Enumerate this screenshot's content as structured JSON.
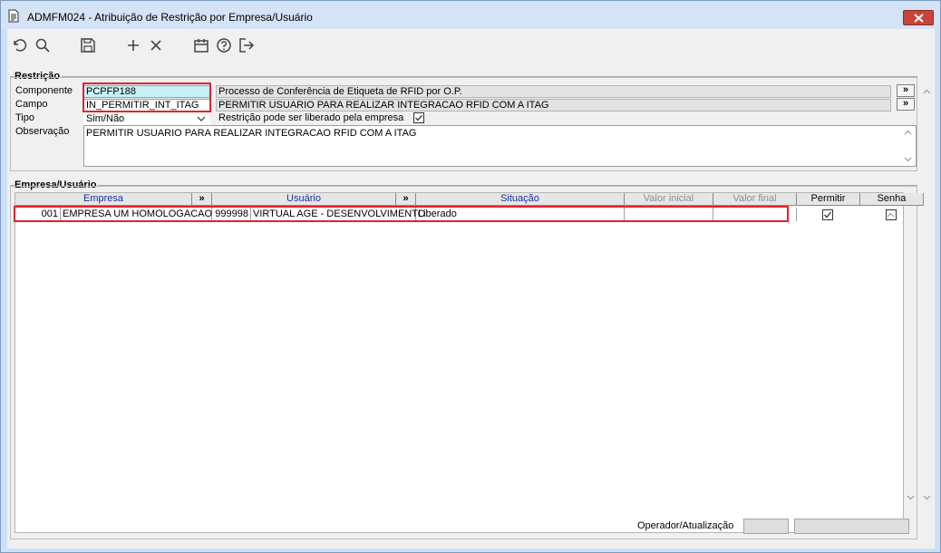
{
  "window": {
    "title": "ADMFM024 - Atribuição de Restrição por Empresa/Usuário",
    "colors": {
      "highlight_border": "#e0242f",
      "field_highlight": "#c7f2f7",
      "header_blue": "#1a2fa8"
    }
  },
  "toolbar": {
    "icons": [
      "undo-icon",
      "search-icon",
      "save-icon",
      "add-icon",
      "delete-icon",
      "calendar-icon",
      "help-icon",
      "exit-icon"
    ]
  },
  "restricao": {
    "title": "Restrição",
    "componente_label": "Componente",
    "componente_value": "PCPFP188",
    "componente_desc": "Processo de Conferência de Etiqueta de RFID por O.P.",
    "campo_label": "Campo",
    "campo_value": "IN_PERMITIR_INT_ITAG",
    "campo_desc": "PERMITIR USUARIO PARA REALIZAR INTEGRACAO RFID COM A ITAG",
    "tipo_label": "Tipo",
    "tipo_value": "Sim/Não",
    "liberado_label": "Restrição pode ser liberado pela empresa",
    "liberado_checked": true,
    "observacao_label": "Observação",
    "observacao_value": "PERMITIR USUARIO PARA REALIZAR INTEGRACAO RFID COM A ITAG",
    "more_button": "»"
  },
  "empresa_usuario": {
    "title": "Empresa/Usuário",
    "columns": {
      "empresa": "Empresa",
      "usuario": "Usuário",
      "situacao": "Situação",
      "valor_inicial": "Valor inicial",
      "valor_final": "Valor final",
      "permitir": "Permitir",
      "senha": "Senha",
      "more": "»"
    },
    "rows": [
      {
        "empresa_code": "001",
        "empresa_name": "EMPRESA UM HOMOLOGACAO",
        "usuario_code": "999998",
        "usuario_name": "VIRTUAL AGE - DESENVOLVIMENTO",
        "situacao": "Liberado",
        "valor_inicial": "",
        "valor_final": "",
        "permitir": true,
        "senha": false
      }
    ]
  },
  "status": {
    "operador_label": "Operador/Atualização",
    "operador_value": "",
    "atualizacao_value": ""
  }
}
